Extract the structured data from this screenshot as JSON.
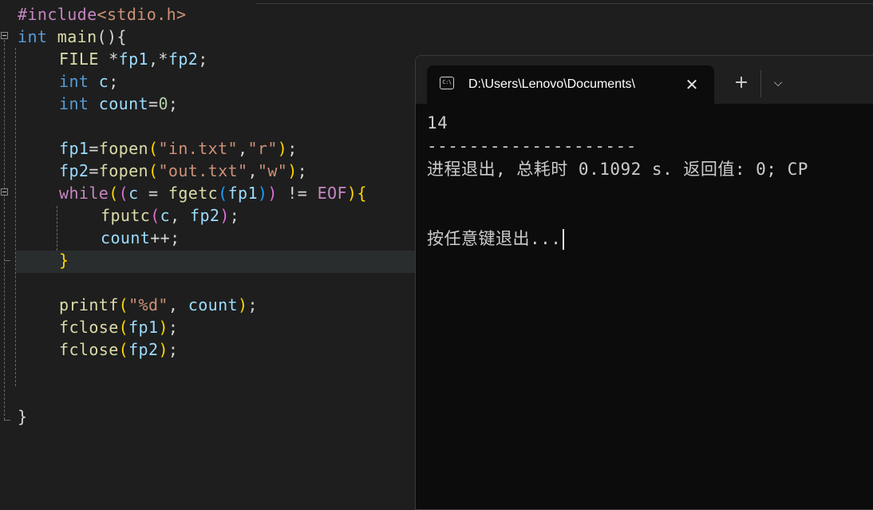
{
  "editor": {
    "lines": [
      [
        {
          "t": "#include",
          "c": "pp"
        },
        {
          "t": "<stdio.h>",
          "c": "str"
        }
      ],
      [
        {
          "t": "int",
          "c": "kw"
        },
        {
          "t": " ",
          "c": "plain"
        },
        {
          "t": "main",
          "c": "fn"
        },
        {
          "t": "(){",
          "c": "plain"
        }
      ],
      [
        {
          "t": "FILE",
          "c": "fn"
        },
        {
          "t": " *",
          "c": "plain"
        },
        {
          "t": "fp1",
          "c": "var"
        },
        {
          "t": ",*",
          "c": "plain"
        },
        {
          "t": "fp2",
          "c": "var"
        },
        {
          "t": ";",
          "c": "plain"
        }
      ],
      [
        {
          "t": "int",
          "c": "kw"
        },
        {
          "t": " ",
          "c": "plain"
        },
        {
          "t": "c",
          "c": "var"
        },
        {
          "t": ";",
          "c": "plain"
        }
      ],
      [
        {
          "t": "int",
          "c": "kw"
        },
        {
          "t": " ",
          "c": "plain"
        },
        {
          "t": "count",
          "c": "var"
        },
        {
          "t": "=",
          "c": "plain"
        },
        {
          "t": "0",
          "c": "num"
        },
        {
          "t": ";",
          "c": "plain"
        }
      ],
      [],
      [
        {
          "t": "fp1",
          "c": "var"
        },
        {
          "t": "=",
          "c": "plain"
        },
        {
          "t": "fopen",
          "c": "fn"
        },
        {
          "t": "(",
          "c": "br1"
        },
        {
          "t": "\"in.txt\"",
          "c": "str"
        },
        {
          "t": ",",
          "c": "plain"
        },
        {
          "t": "\"r\"",
          "c": "str"
        },
        {
          "t": ")",
          "c": "br1"
        },
        {
          "t": ";",
          "c": "plain"
        }
      ],
      [
        {
          "t": "fp2",
          "c": "var"
        },
        {
          "t": "=",
          "c": "plain"
        },
        {
          "t": "fopen",
          "c": "fn"
        },
        {
          "t": "(",
          "c": "br1"
        },
        {
          "t": "\"out.txt\"",
          "c": "str"
        },
        {
          "t": ",",
          "c": "plain"
        },
        {
          "t": "\"w\"",
          "c": "str"
        },
        {
          "t": ")",
          "c": "br1"
        },
        {
          "t": ";",
          "c": "plain"
        }
      ],
      [
        {
          "t": "while",
          "c": "pp"
        },
        {
          "t": "(",
          "c": "br1"
        },
        {
          "t": "(",
          "c": "br2"
        },
        {
          "t": "c",
          "c": "var"
        },
        {
          "t": " = ",
          "c": "plain"
        },
        {
          "t": "fgetc",
          "c": "fn"
        },
        {
          "t": "(",
          "c": "br3"
        },
        {
          "t": "fp1",
          "c": "var"
        },
        {
          "t": ")",
          "c": "br3"
        },
        {
          "t": ")",
          "c": "br2"
        },
        {
          "t": " != ",
          "c": "plain"
        },
        {
          "t": "EOF",
          "c": "mac"
        },
        {
          "t": ")",
          "c": "br1"
        },
        {
          "t": "{",
          "c": "br1"
        }
      ],
      [
        {
          "t": "fputc",
          "c": "fn"
        },
        {
          "t": "(",
          "c": "br2"
        },
        {
          "t": "c",
          "c": "var"
        },
        {
          "t": ", ",
          "c": "plain"
        },
        {
          "t": "fp2",
          "c": "var"
        },
        {
          "t": ")",
          "c": "br2"
        },
        {
          "t": ";",
          "c": "plain"
        }
      ],
      [
        {
          "t": "count",
          "c": "var"
        },
        {
          "t": "++;",
          "c": "plain"
        }
      ],
      [
        {
          "t": "}",
          "c": "br1"
        }
      ],
      [],
      [
        {
          "t": "printf",
          "c": "fn"
        },
        {
          "t": "(",
          "c": "br1"
        },
        {
          "t": "\"%d\"",
          "c": "str"
        },
        {
          "t": ", ",
          "c": "plain"
        },
        {
          "t": "count",
          "c": "var"
        },
        {
          "t": ")",
          "c": "br1"
        },
        {
          "t": ";",
          "c": "plain"
        }
      ],
      [
        {
          "t": "fclose",
          "c": "fn"
        },
        {
          "t": "(",
          "c": "br1"
        },
        {
          "t": "fp1",
          "c": "var"
        },
        {
          "t": ")",
          "c": "br1"
        },
        {
          "t": ";",
          "c": "plain"
        }
      ],
      [
        {
          "t": "fclose",
          "c": "fn"
        },
        {
          "t": "(",
          "c": "br1"
        },
        {
          "t": "fp2",
          "c": "var"
        },
        {
          "t": ")",
          "c": "br1"
        },
        {
          "t": ";",
          "c": "plain"
        }
      ],
      [],
      [],
      [
        {
          "t": "}",
          "c": "plain"
        }
      ]
    ]
  },
  "terminal": {
    "tab_title": "D:\\Users\\Lenovo\\Documents\\",
    "tab_icon_glyph": "C:\\",
    "close_glyph": "✕",
    "new_tab_glyph": "+",
    "dropdown_glyph": "⌵",
    "output": [
      "14",
      "--------------------",
      "进程退出, 总耗时 0.1092 s. 返回值: 0; CP",
      "",
      "按任意键退出..."
    ]
  }
}
